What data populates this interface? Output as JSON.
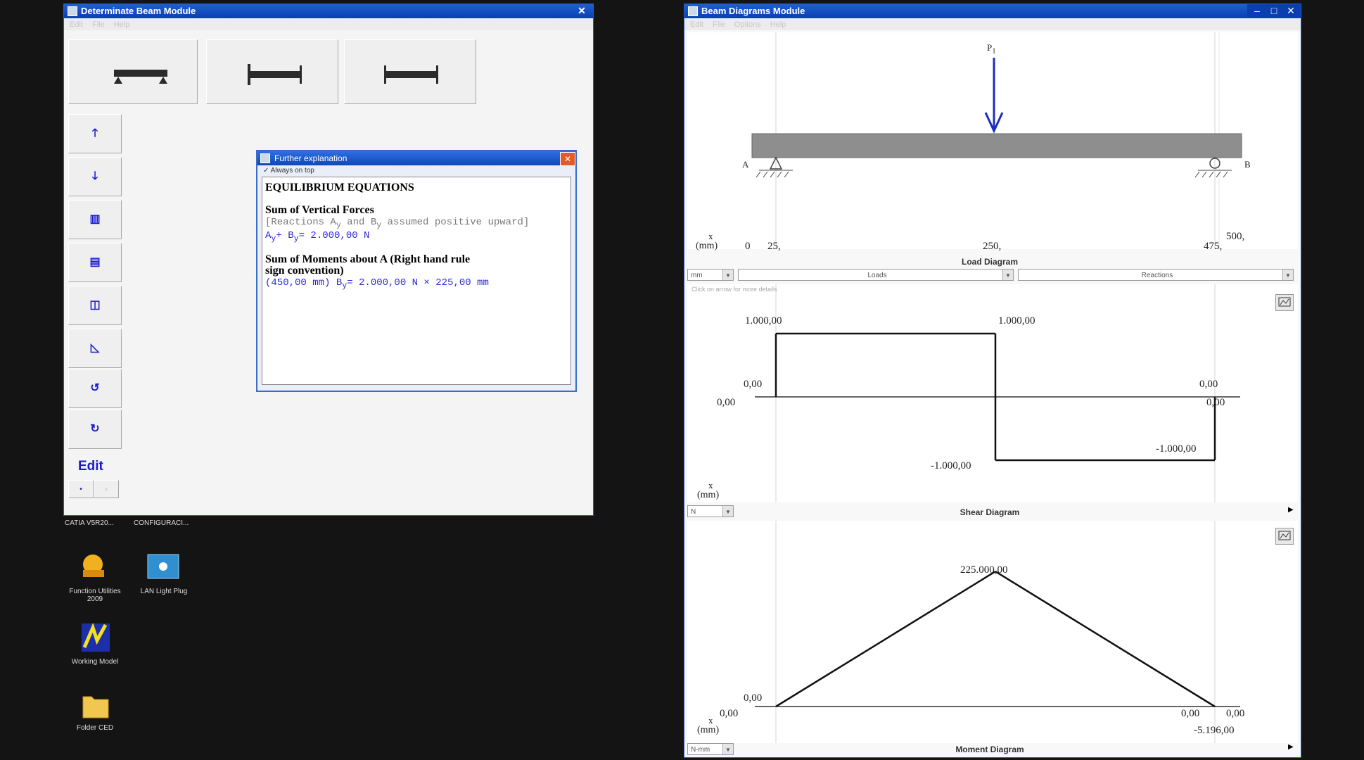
{
  "left_window": {
    "title": "Determinate Beam Module",
    "menu": "Edit  File  Help",
    "top_buttons": [
      "simply-supported",
      "fixed-fixed",
      "cantilever"
    ],
    "side_buttons": [
      "up-arrow-load",
      "down-arrow-load",
      "distributed-load-up",
      "distributed-load-down",
      "varying-load",
      "triangular-load",
      "moment-ccw",
      "moment-cw"
    ],
    "edit_label": "Edit"
  },
  "dialog": {
    "title": "Further explanation",
    "subtoolbar": "Always on top",
    "heading": "EQUILIBRIUM EQUATIONS",
    "sec1_title": "Sum of Vertical Forces",
    "sec1_note_pre": "[Reactions A",
    "sec1_note_sub1": "y",
    "sec1_note_mid": " and B",
    "sec1_note_sub2": "y",
    "sec1_note_post": " assumed positive upward]",
    "sec1_eq_a": "A",
    "sec1_eq_sub1": "y",
    "sec1_eq_mid": "+ B",
    "sec1_eq_sub2": "y",
    "sec1_eq_post": "= 2.000,00 N",
    "sec2_title_l1": "Sum of Moments about A  (Right hand rule",
    "sec2_title_l2": "sign convention)",
    "sec2_eq_pre": "(450,00 mm) B",
    "sec2_eq_sub": "y",
    "sec2_eq_post": "= 2.000,00 N × 225,00 mm"
  },
  "desktop": {
    "taskbar_items": [
      "CATIA V5R20...",
      "CONFIGURACI..."
    ],
    "icons": [
      {
        "name": "Function Utilities 2009",
        "label": "Function Utilities 2009"
      },
      {
        "name": "LAN Light Plug",
        "label": "LAN Light Plug"
      },
      {
        "name": "Working Model",
        "label": "Working Model"
      },
      {
        "name": "Folder CED",
        "label": "Folder CED"
      }
    ]
  },
  "right_window": {
    "title": "Beam Diagrams Module",
    "menu": "Edit  File  Options  Help",
    "load_diagram": {
      "load_label": "P",
      "load_sub": "1",
      "support_a": "A",
      "support_b": "B",
      "x_axis_label": "x",
      "x_unit": "(mm)",
      "ticks": [
        "0",
        "25,",
        "250,",
        "475,",
        "500,"
      ],
      "caption": "Load Diagram"
    },
    "combos": [
      "mm",
      "Loads",
      "Reactions"
    ],
    "shear_hint": "Click on arrow for more details",
    "shear_diagram": {
      "labels": [
        "1.000,00",
        "1.000,00",
        "0,00",
        "0,00",
        "0,00",
        "0,00",
        "-1.000,00",
        "-1.000,00"
      ],
      "x_axis_label": "x",
      "x_unit": "(mm)",
      "unit_combo": "N",
      "caption": "Shear Diagram"
    },
    "moment_diagram": {
      "labels": [
        "225.000,00",
        "0,00",
        "0,00",
        "0,00",
        "0,00",
        "-5.196,00"
      ],
      "x_axis_label": "x",
      "x_unit": "(mm)",
      "unit_combo": "N-mm",
      "caption": "Moment Diagram"
    }
  },
  "chart_data": [
    {
      "type": "line",
      "title": "Shear Diagram",
      "x": [
        25,
        25,
        250,
        250,
        475,
        475
      ],
      "y": [
        0,
        1000,
        1000,
        -1000,
        -1000,
        0
      ],
      "xlabel": "x (mm)",
      "ylabel": "N"
    },
    {
      "type": "line",
      "title": "Moment Diagram",
      "x": [
        25,
        250,
        475
      ],
      "y": [
        0,
        225000,
        0
      ],
      "xlabel": "x (mm)",
      "ylabel": "N-mm"
    }
  ]
}
